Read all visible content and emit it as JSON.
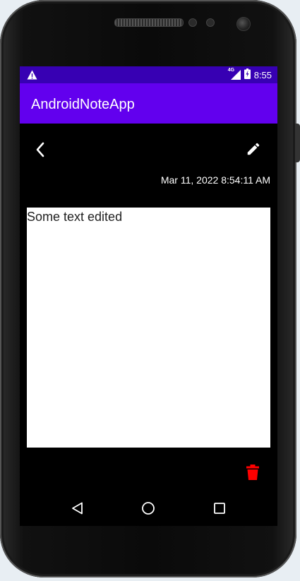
{
  "device": {
    "status_bar": {
      "network_label": "4G",
      "time": "8:55",
      "color": "#3700b3"
    }
  },
  "app_bar": {
    "title": "AndroidNoteApp",
    "color": "#6200ee"
  },
  "toolbar": {
    "back_icon": "chevron-left-icon",
    "edit_icon": "pencil-icon"
  },
  "note": {
    "timestamp": "Mar 11, 2022 8:54:11 AM",
    "content": "Some text edited"
  },
  "actions": {
    "delete_icon": "trash-icon",
    "delete_color": "#ff0000"
  },
  "navigation": {
    "back_icon": "nav-back-icon",
    "home_icon": "nav-home-icon",
    "recents_icon": "nav-recents-icon"
  }
}
